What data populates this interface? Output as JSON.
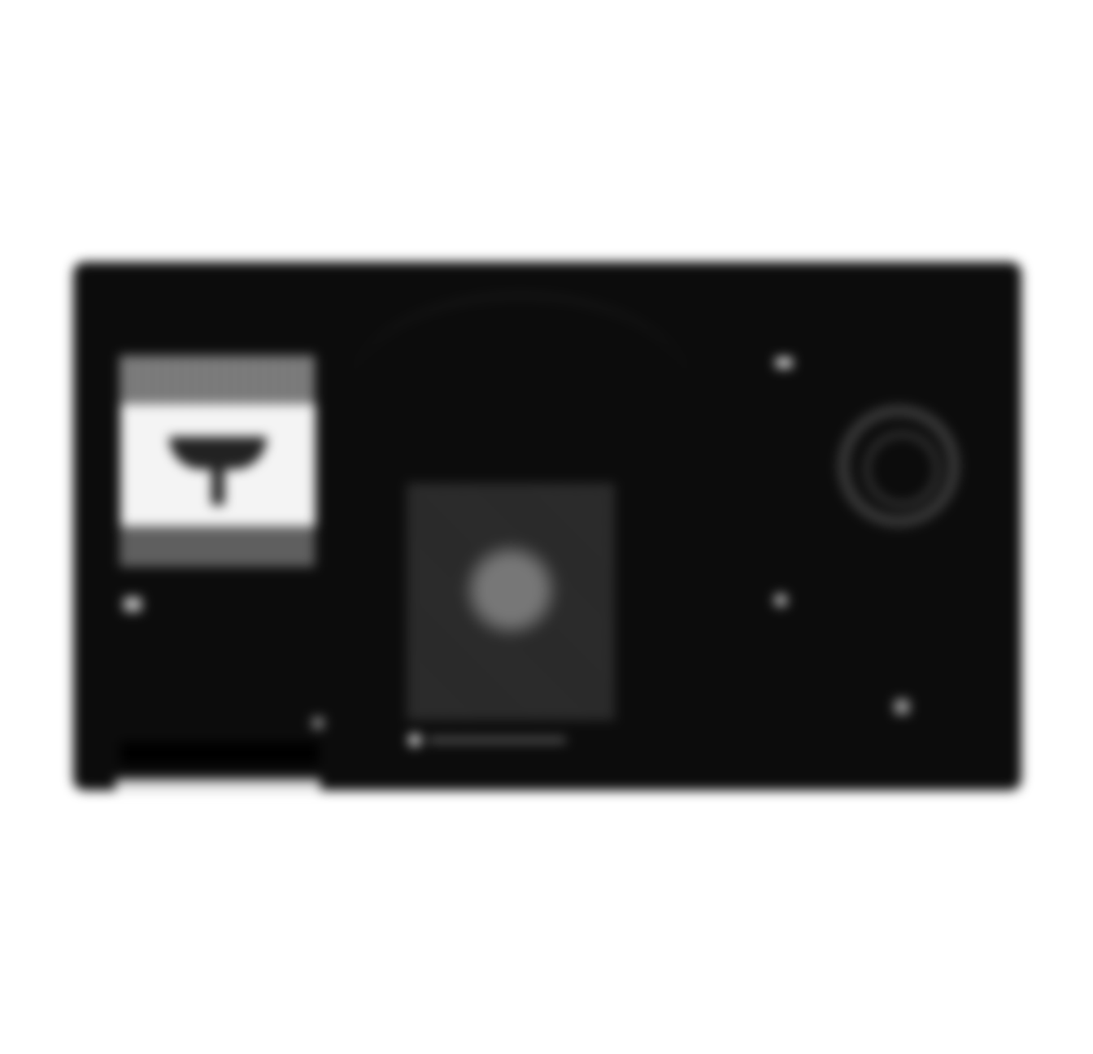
{
  "left": {
    "meta_label": "",
    "tab_label": ""
  },
  "middle": {
    "art_title": "",
    "art_subtitle": "",
    "caption": ""
  },
  "right": {
    "badge": "",
    "label": "",
    "side_text": "",
    "headline": "",
    "byline": "",
    "footer_label": ""
  },
  "colors": {
    "background": "#0c0c0c",
    "page": "#ffffff"
  }
}
